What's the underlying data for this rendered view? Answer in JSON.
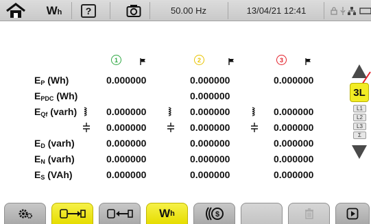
{
  "status_bar": {
    "mode": "Wh",
    "help_label": "?",
    "frequency": "50.00 Hz",
    "datetime": "13/04/21 12:41",
    "icons": [
      "home-icon",
      "help-icon",
      "camera-icon",
      "lock-icon",
      "mic-icon",
      "network-icon",
      "battery-icon"
    ]
  },
  "phases": [
    {
      "label": "1",
      "color": "#2fa843"
    },
    {
      "label": "2",
      "color": "#e9c300"
    },
    {
      "label": "3",
      "color": "#e3202a"
    }
  ],
  "rows": [
    {
      "label": "E",
      "sub": "P",
      "unit": " (Wh)",
      "values": [
        "0.000000",
        "0.000000",
        "0.000000"
      ]
    },
    {
      "label": "E",
      "sub": "PDC",
      "unit": " (Wh)",
      "values": [
        "",
        "0.000000",
        ""
      ]
    },
    {
      "label": "E",
      "sub": "Qf",
      "unit": " (varh)",
      "values": [
        "0.000000",
        "0.000000",
        "0.000000"
      ]
    },
    {
      "label": "",
      "sub": "",
      "unit": "",
      "values": [
        "0.000000",
        "0.000000",
        "0.000000"
      ]
    },
    {
      "label": "E",
      "sub": "D",
      "unit": " (varh)",
      "values": [
        "0.000000",
        "0.000000",
        "0.000000"
      ]
    },
    {
      "label": "E",
      "sub": "N",
      "unit": " (varh)",
      "values": [
        "0.000000",
        "0.000000",
        "0.000000"
      ]
    },
    {
      "label": "E",
      "sub": "S",
      "unit": " (VAh)",
      "values": [
        "0.000000",
        "0.000000",
        "0.000000"
      ]
    }
  ],
  "side_nav": {
    "selected": "3L",
    "options": [
      "L1",
      "L2",
      "L3",
      "Σ"
    ]
  },
  "tabs": [
    {
      "name": "settings-tab",
      "icon": "gear-icon"
    },
    {
      "name": "energy-consumed-tab",
      "icon": "meter-consumed-icon",
      "active": true
    },
    {
      "name": "energy-generated-tab",
      "icon": "meter-generated-icon"
    },
    {
      "name": "wh-tab",
      "label": "W",
      "label_sub": "h",
      "active": true
    },
    {
      "name": "cost-tab",
      "icon": "currency-icon"
    },
    {
      "name": "empty-tab"
    },
    {
      "name": "reset-tab",
      "icon": "trash-icon",
      "disabled": true
    },
    {
      "name": "play-tab",
      "icon": "play-icon"
    }
  ]
}
